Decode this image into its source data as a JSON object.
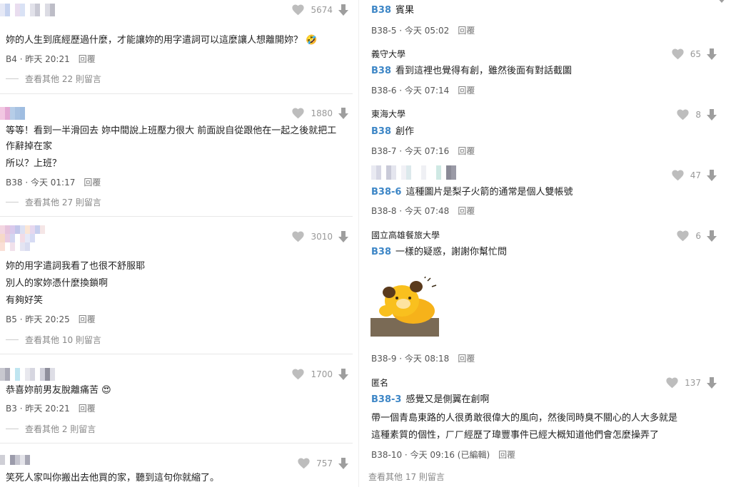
{
  "left": [
    {
      "likes": "5674",
      "text_lines": [
        "妳的人生到底經歷過什麼，才能讓妳的用字遣詞可以這麼讓人想離開妳？ 🤣"
      ],
      "floor": "B4",
      "time": "昨天 20:21",
      "reply": "回覆",
      "more": "查看其他 22 則留言"
    },
    {
      "likes": "1880",
      "text_lines": [
        "等等！看到一半滑回去 妳中間說上班壓力很大 前面說自從跟他在一起之後就把工",
        "作辭掉在家",
        "所以？上班？"
      ],
      "floor": "B38",
      "time": "今天 01:17",
      "reply": "回覆",
      "more": "查看其他 27 則留言"
    },
    {
      "likes": "3010",
      "text_lines": [
        "妳的用字遣詞我看了也很不舒服耶",
        "別人的家妳憑什麼換鎖啊",
        "有夠好笑"
      ],
      "floor": "B5",
      "time": "昨天 20:25",
      "reply": "回覆",
      "more": "查看其他 10 則留言"
    },
    {
      "likes": "1700",
      "text_lines": [
        "恭喜妳前男友脫離痛苦 😍"
      ],
      "floor": "B3",
      "time": "昨天 20:21",
      "reply": "回覆",
      "more": "查看其他 2 則留言"
    },
    {
      "likes": "757",
      "text_lines": [
        "笑死人家叫你搬出去他買的家，聽到這句你就縮了。"
      ]
    }
  ],
  "right": [
    {
      "author": "",
      "likes": "",
      "ref": "B38",
      "text": "賓果",
      "floor": "B38-5",
      "time": "今天 05:02",
      "reply": "回覆"
    },
    {
      "author": "義守大學",
      "likes": "65",
      "ref": "B38",
      "text": "看到這裡也覺得有創，雖然後面有對話截圖",
      "floor": "B38-6",
      "time": "今天 07:14",
      "reply": "回覆"
    },
    {
      "author": "東海大學",
      "likes": "8",
      "ref": "B38",
      "text": "創作",
      "floor": "B38-7",
      "time": "今天 07:16",
      "reply": "回覆"
    },
    {
      "author": "",
      "likes": "47",
      "ref": "B38-6",
      "text": "這種圖片是梨子火箭的通常是個人雙帳號",
      "floor": "B38-8",
      "time": "今天 07:48",
      "reply": "回覆"
    },
    {
      "author": "國立高雄餐旅大學",
      "likes": "6",
      "ref": "B38",
      "text": "一樣的疑惑，謝謝你幫忙問",
      "floor": "B38-9",
      "time": "今天 08:18",
      "reply": "回覆"
    },
    {
      "author": "匿名",
      "likes": "137",
      "ref": "B38-3",
      "text": "感覺又是側翼在創啊",
      "extra_lines": [
        "帶一個青島東路的人很勇敢很偉大的風向，然後同時臭不關心的人大多就是",
        "這種素質的個性，ㄏㄏ經歷了瑋豐事件已經大概知道他們會怎麼操弄了"
      ],
      "floor": "B38-10",
      "time": "今天 09:16 (已編輯)",
      "reply": "回覆"
    }
  ],
  "right_more": "查看其他 17 則留言",
  "colors": {
    "link": "#3d86c6",
    "icon": "#bdbdbd",
    "meta": "#555555"
  }
}
